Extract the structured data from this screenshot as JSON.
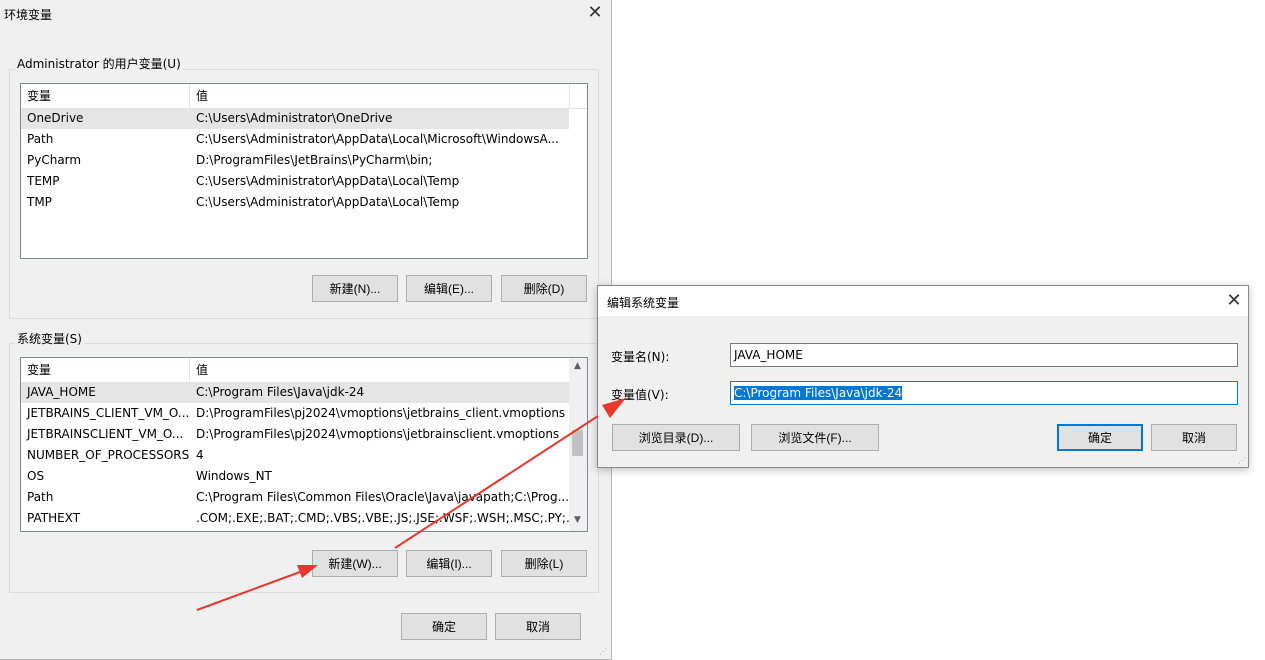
{
  "main_dialog": {
    "title": "环境变量",
    "user_group_label": "Administrator 的用户变量(U)",
    "user_columns": [
      "变量",
      "值"
    ],
    "user_vars": [
      {
        "name": "OneDrive",
        "value": "C:\\Users\\Administrator\\OneDrive"
      },
      {
        "name": "Path",
        "value": "C:\\Users\\Administrator\\AppData\\Local\\Microsoft\\WindowsA..."
      },
      {
        "name": "PyCharm",
        "value": "D:\\ProgramFiles\\JetBrains\\PyCharm\\bin;"
      },
      {
        "name": "TEMP",
        "value": "C:\\Users\\Administrator\\AppData\\Local\\Temp"
      },
      {
        "name": "TMP",
        "value": "C:\\Users\\Administrator\\AppData\\Local\\Temp"
      }
    ],
    "user_buttons": {
      "new": "新建(N)...",
      "edit": "编辑(E)...",
      "delete": "删除(D)"
    },
    "system_group_label": "系统变量(S)",
    "system_columns": [
      "变量",
      "值"
    ],
    "system_vars": [
      {
        "name": "JAVA_HOME",
        "value": "C:\\Program Files\\Java\\jdk-24"
      },
      {
        "name": "JETBRAINS_CLIENT_VM_O...",
        "value": "D:\\ProgramFiles\\pj2024\\vmoptions\\jetbrains_client.vmoptions"
      },
      {
        "name": "JETBRAINSCLIENT_VM_O...",
        "value": "D:\\ProgramFiles\\pj2024\\vmoptions\\jetbrainsclient.vmoptions"
      },
      {
        "name": "NUMBER_OF_PROCESSORS",
        "value": "4"
      },
      {
        "name": "OS",
        "value": "Windows_NT"
      },
      {
        "name": "Path",
        "value": "C:\\Program Files\\Common Files\\Oracle\\Java\\javapath;C:\\Prog..."
      },
      {
        "name": "PATHEXT",
        "value": ".COM;.EXE;.BAT;.CMD;.VBS;.VBE;.JS;.JSE;.WSF;.WSH;.MSC;.PY;.P..."
      }
    ],
    "system_buttons": {
      "new": "新建(W)...",
      "edit": "编辑(I)...",
      "delete": "删除(L)"
    },
    "ok": "确定",
    "cancel": "取消"
  },
  "edit_dialog": {
    "title": "编辑系统变量",
    "name_label": "变量名(N):",
    "value_label": "变量值(V):",
    "name_value": "JAVA_HOME",
    "value_value": "C:\\Program Files\\Java\\jdk-24",
    "browse_dir": "浏览目录(D)...",
    "browse_file": "浏览文件(F)...",
    "ok": "确定",
    "cancel": "取消"
  },
  "colors": {
    "annotation_arrow": "#e8372c",
    "accent": "#0078d7"
  }
}
